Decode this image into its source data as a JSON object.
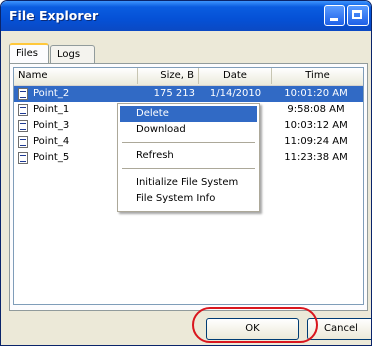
{
  "window": {
    "title": "File Explorer"
  },
  "tabs": [
    {
      "label": "Files"
    },
    {
      "label": "Logs"
    }
  ],
  "columns": {
    "name": "Name",
    "size": "Size, B",
    "date": "Date",
    "time": "Time"
  },
  "files": [
    {
      "name": "Point_2",
      "size": "175 213",
      "date": "1/14/2010",
      "time": "10:01:20 AM"
    },
    {
      "name": "Point_1",
      "size": "",
      "date": "10",
      "time": "9:58:08 AM"
    },
    {
      "name": "Point_3",
      "size": "",
      "date": "10",
      "time": "10:03:12 AM"
    },
    {
      "name": "Point_4",
      "size": "",
      "date": "10",
      "time": "11:09:24 AM"
    },
    {
      "name": "Point_5",
      "size": "",
      "date": "10",
      "time": "11:23:38 AM"
    }
  ],
  "context_menu": {
    "delete": "Delete",
    "download": "Download",
    "refresh": "Refresh",
    "init": "Initialize File System",
    "info": "File System Info"
  },
  "buttons": {
    "ok": "OK",
    "cancel": "Cancel"
  },
  "colors": {
    "titlebar": "#0551d6",
    "selection": "#316ac5",
    "highlight_ring": "#d9161e"
  }
}
